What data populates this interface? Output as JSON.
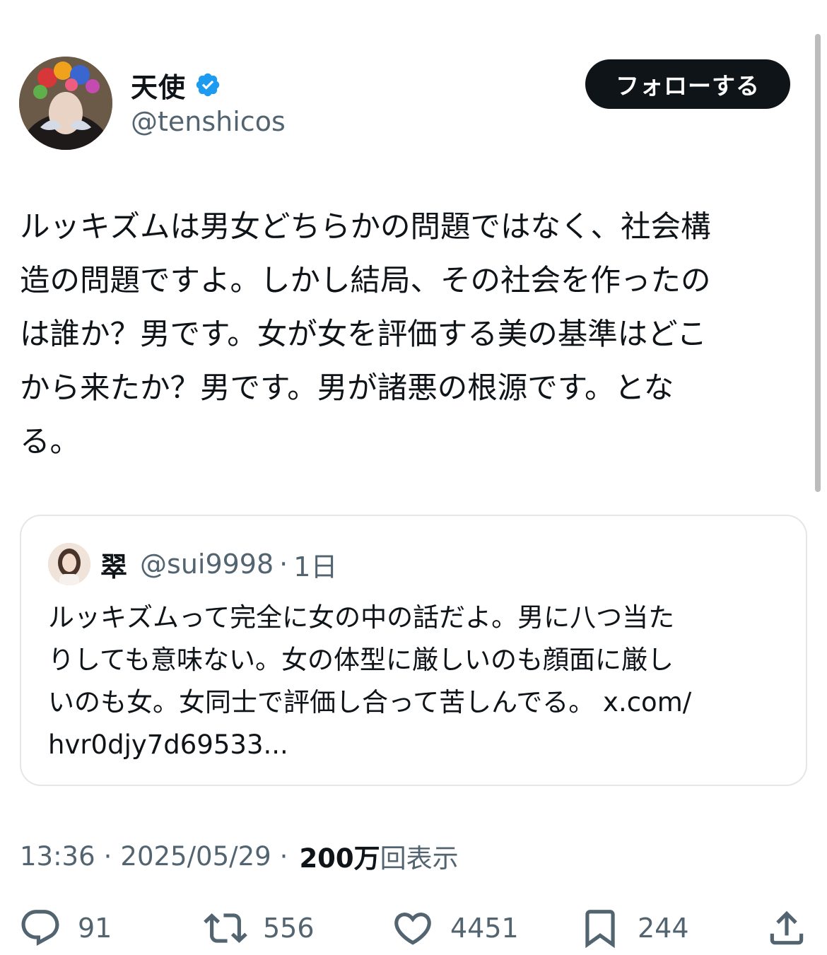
{
  "author": {
    "display_name": "天使",
    "handle": "@tenshicos",
    "verified_color": "#1d9bf0"
  },
  "follow_button": {
    "label": "フォローする"
  },
  "tweet": {
    "text": "ルッキズムは男女どちらかの問題ではなく、社会構\n造の問題ですよ。しかし結局、その社会を作ったの\nは誰か？男です。女が女を評価する美の基準はどこ\nから来たか？男です。男が諸悪の根源です。とな\nる。"
  },
  "quoted": {
    "name": "翠",
    "handle": "@sui9998",
    "dot": "·",
    "time": "1日",
    "text": "ルッキズムって完全に女の中の話だよ。男に八つ当た\nりしても意味ない。女の体型に厳しいのも顔面に厳し\nいのも女。女同士で評価し合って苦しんでる。 x.com/\nhvr0djy7d69533..."
  },
  "meta": {
    "time": "13:36",
    "sep": "·",
    "date": "2025/05/29",
    "views_count": "200万",
    "views_label": "回表示"
  },
  "actions": {
    "reply_count": "91",
    "retweet_count": "556",
    "like_count": "4451",
    "bookmark_count": "244",
    "icons": [
      "reply-icon",
      "retweet-icon",
      "like-icon",
      "bookmark-icon",
      "share-icon"
    ]
  },
  "colors": {
    "text_primary": "#0f1419",
    "text_secondary": "#536471",
    "border": "#e3e7ea",
    "accent": "#1d9bf0"
  }
}
